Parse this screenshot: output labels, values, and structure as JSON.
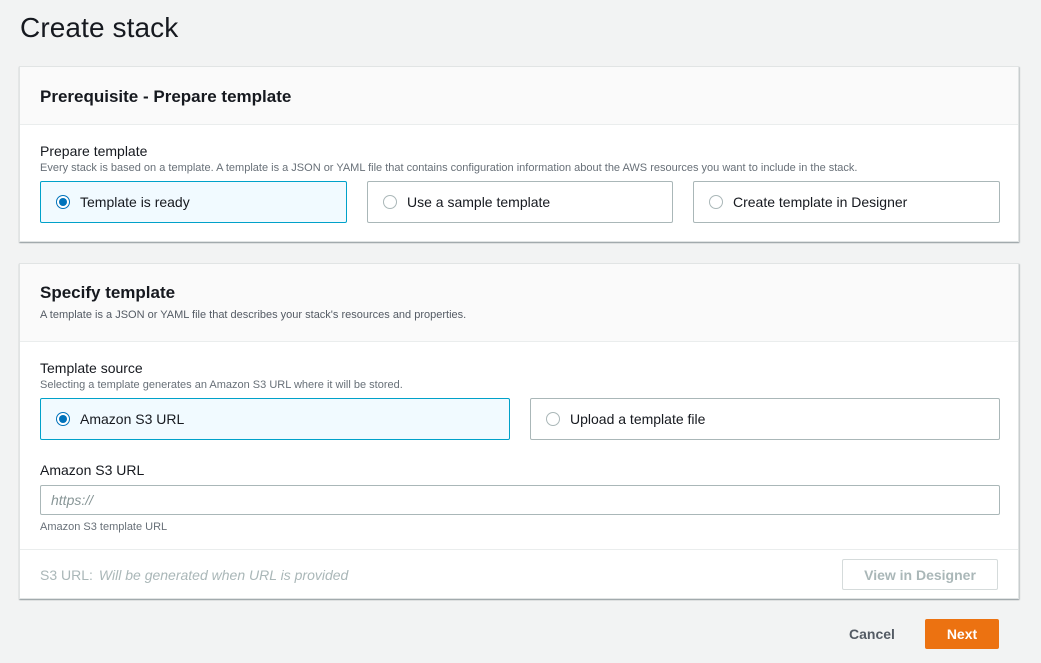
{
  "page": {
    "title": "Create stack"
  },
  "prerequisite": {
    "heading": "Prerequisite - Prepare template",
    "field_label": "Prepare template",
    "field_description": "Every stack is based on a template. A template is a JSON or YAML file that contains configuration information about the AWS resources you want to include in the stack.",
    "options": [
      {
        "label": "Template is ready",
        "selected": true
      },
      {
        "label": "Use a sample template",
        "selected": false
      },
      {
        "label": "Create template in Designer",
        "selected": false
      }
    ]
  },
  "specify": {
    "heading": "Specify template",
    "description": "A template is a JSON or YAML file that describes your stack's resources and properties.",
    "source_label": "Template source",
    "source_description": "Selecting a template generates an Amazon S3 URL where it will be stored.",
    "source_options": [
      {
        "label": "Amazon S3 URL",
        "selected": true
      },
      {
        "label": "Upload a template file",
        "selected": false
      }
    ],
    "url_label": "Amazon S3 URL",
    "url_value": "",
    "url_placeholder": "https://",
    "url_hint": "Amazon S3 template URL",
    "s3_url_label": "S3 URL:",
    "s3_url_value": "Will be generated when URL is provided",
    "view_designer_label": "View in Designer"
  },
  "footer": {
    "cancel_label": "Cancel",
    "next_label": "Next"
  },
  "colors": {
    "primary_button": "#ec7211",
    "selected_border": "#00a1c9",
    "selected_background": "#f1faff",
    "radio_selected": "#0073bb"
  }
}
